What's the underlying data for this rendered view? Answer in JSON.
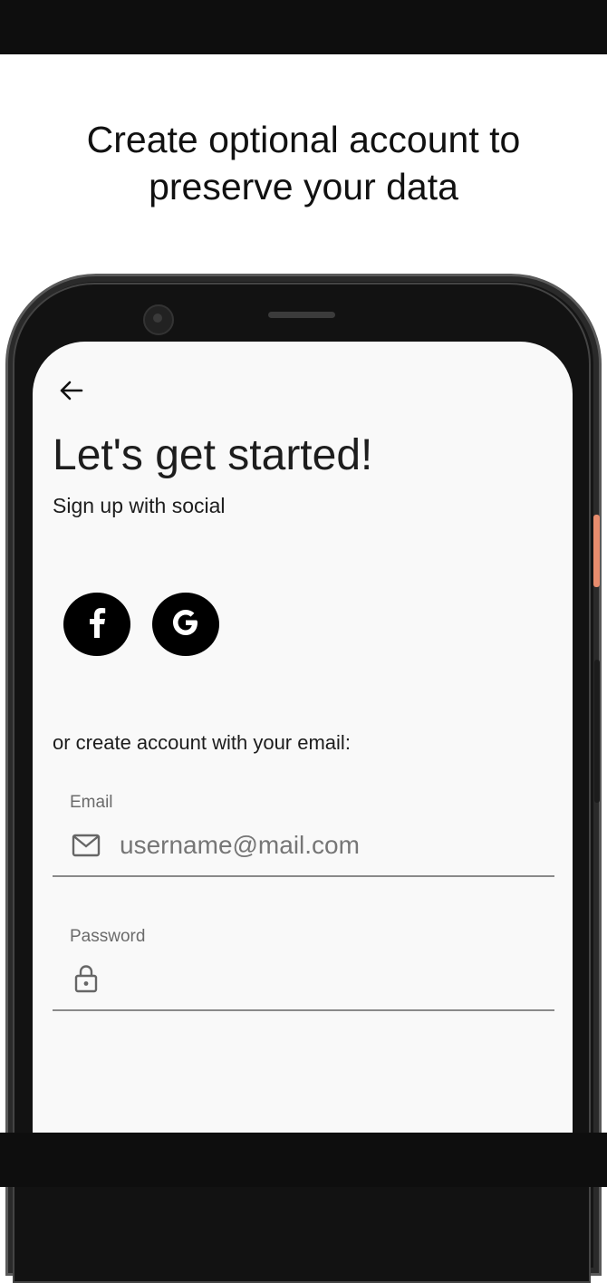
{
  "headline": {
    "line1": "Create optional account to",
    "line2": "preserve your data"
  },
  "screen": {
    "title": "Let's get started!",
    "subtitle": "Sign up with social",
    "social": {
      "facebook_glyph": "f",
      "google_glyph": "G"
    },
    "or_text": "or create account with your email:",
    "email": {
      "label": "Email",
      "placeholder": "username@mail.com",
      "icon": "mail-icon"
    },
    "password": {
      "label": "Password",
      "placeholder": "",
      "icon": "lock-icon"
    }
  },
  "colors": {
    "accent_side_button": "#e88c6d",
    "screen_bg": "#f9f9f9"
  }
}
